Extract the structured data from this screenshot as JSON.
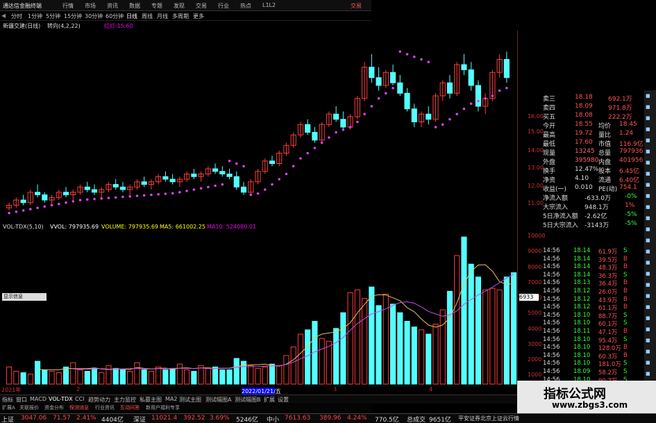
{
  "window_title": "通达信金融终端",
  "menu": [
    "行情",
    "市场",
    "资讯",
    "数据",
    "专题",
    "发现",
    "交易",
    "行业",
    "热点",
    "L1L2",
    "交易"
  ],
  "periods": [
    "分时",
    "1分钟",
    "5分钟",
    "15分钟",
    "30分钟",
    "60分钟",
    "日线",
    "周线",
    "月线",
    "多周期",
    "更多"
  ],
  "stock_line": {
    "name": "新疆交建(日线)",
    "indicator": "转向(4,2,22)",
    "extra": "红灯:15.60"
  },
  "indicator_bar": {
    "name": "VOL-TDX(5,10)",
    "vvol": "VVOL: 797935.69",
    "volume": "VOLUME: 797935.69",
    "ma5": "MA5: 661002.25",
    "ma10": "MA10: 524080.01"
  },
  "y_axis_price": [
    "16.00",
    "15.00",
    "14.00",
    "13.00",
    "12.00",
    "11.00"
  ],
  "y_axis_vol": [
    "10000",
    "9000",
    "8000",
    "7000",
    "6000",
    "5000",
    "4000",
    "3000",
    "2000",
    "1000"
  ],
  "vol_label": "6933",
  "popup": "显示信息",
  "date_left": "2021年",
  "date_box": "2022/01/21/五",
  "date_marks": [
    "2",
    "3",
    "4"
  ],
  "tabs": [
    "指标",
    "窗口",
    "MACD",
    "VOL-TDX",
    "CCI",
    "趋势动力",
    "主力监控",
    "私募主图",
    "MA2",
    "测试主图",
    "测试幅图A",
    "测试幅图B",
    "扩展",
    "设置"
  ],
  "tabs2": [
    "扩展A",
    "关联报价",
    "资金分布",
    "探测消息",
    "行业资讯",
    "互动问答",
    "新用户福利专享"
  ],
  "quotes": [
    {
      "label": "卖三",
      "v1": "18.18",
      "v2": "692.1万"
    },
    {
      "label": "卖四",
      "v1": "18.09",
      "v2": "971.8万"
    },
    {
      "label": "买五",
      "v1": "18.08",
      "v2": "222.2万"
    },
    {
      "label": "今开",
      "v1": "18.55",
      "k2": "均价",
      "v2": "18.45"
    },
    {
      "label": "最高",
      "v1": "19.72",
      "k2": "量比",
      "v2": "1.24"
    },
    {
      "label": "最低",
      "v1": "17.60",
      "k2": "市值",
      "v2": "116.9亿"
    },
    {
      "label": "现量",
      "v1": "13245",
      "k2": "总量",
      "v2": "797936"
    },
    {
      "label": "外盘",
      "v1": "395980",
      "k2": "内盘",
      "v2": "401956"
    },
    {
      "label": "换手",
      "v1": "12.47%",
      "k2": "股本",
      "v2": "6.45亿"
    },
    {
      "label": "净资",
      "v1": "4.10",
      "k2": "流通",
      "v2": "6.40亿"
    },
    {
      "label": "收益(一)",
      "v1": "0.010",
      "k2": "PE(动)",
      "v2": "754.1"
    },
    {
      "label": "净流入额",
      "v1": "-633.0万",
      "v2": "-0%"
    },
    {
      "label": "大宗流入",
      "v1": "948.1万",
      "v2": "1%"
    },
    {
      "label": "5日净流入额",
      "v1": "-2.62亿",
      "v2": "-5%"
    },
    {
      "label": "5日大宗流入",
      "v1": "-3143万",
      "v2": "-5%"
    }
  ],
  "ticks": [
    [
      "14:56",
      "18.14",
      "61.9万",
      "S"
    ],
    [
      "14:56",
      "18.14",
      "39.5万",
      "B"
    ],
    [
      "14:56",
      "18.14",
      "48.3万",
      "B"
    ],
    [
      "14:56",
      "18.14",
      "36.3万",
      "S"
    ],
    [
      "14:56",
      "18.13",
      "36.4万",
      "B"
    ],
    [
      "14:56",
      "18.12",
      "26.0万",
      "B"
    ],
    [
      "14:56",
      "18.12",
      "43.9万",
      "B"
    ],
    [
      "14:56",
      "18.12",
      "61.1万",
      "B"
    ],
    [
      "14:56",
      "18.10",
      "88.7万",
      "S"
    ],
    [
      "14:56",
      "18.10",
      "60.1万",
      "S"
    ],
    [
      "14:56",
      "18.11",
      "47.1万",
      "B"
    ],
    [
      "14:56",
      "18.10",
      "95.4万",
      "S"
    ],
    [
      "14:56",
      "18.10",
      "128.0万",
      "B"
    ],
    [
      "14:56",
      "18.10",
      "60.3万",
      "B"
    ],
    [
      "14:56",
      "18.10",
      "181.0万",
      "S"
    ],
    [
      "14:56",
      "18.09",
      "58.2万",
      "S"
    ],
    [
      "14:56",
      "18.10",
      "90.7万",
      "S"
    ]
  ],
  "status": [
    {
      "label": "上证",
      "value": "3047.06",
      "chg": "71.57",
      "pct": "2.41%",
      "amt": "4404亿"
    },
    {
      "label": "深证",
      "value": "11021.4",
      "chg": "392.52",
      "pct": "3.69%",
      "amt": "5246亿"
    },
    {
      "label": "中小",
      "value": "7613.63",
      "chg": "389.96",
      "pct": "4.24%",
      "amt": "770.5亿"
    },
    {
      "label": "总成交",
      "value": "9651亿"
    },
    {
      "label": "info",
      "value": "平安证券北京上证云行情"
    }
  ],
  "watermark": {
    "title": "指标公式网",
    "url": "www.zbgs3.com"
  },
  "chart_data": {
    "type": "bar",
    "candles": [
      [
        10.9,
        11.1,
        10.8,
        11.0
      ],
      [
        11.0,
        11.3,
        10.9,
        11.2
      ],
      [
        11.2,
        11.4,
        11.0,
        11.1
      ],
      [
        11.1,
        11.6,
        11.0,
        11.5
      ],
      [
        11.5,
        11.8,
        11.3,
        11.4
      ],
      [
        11.4,
        11.5,
        11.1,
        11.2
      ],
      [
        11.2,
        11.4,
        11.0,
        11.3
      ],
      [
        11.3,
        11.6,
        11.2,
        11.5
      ],
      [
        11.5,
        11.7,
        11.3,
        11.4
      ],
      [
        11.4,
        11.6,
        11.2,
        11.5
      ],
      [
        11.5,
        11.8,
        11.4,
        11.7
      ],
      [
        11.7,
        11.9,
        11.5,
        11.6
      ],
      [
        11.6,
        11.8,
        11.4,
        11.5
      ],
      [
        11.5,
        11.7,
        11.3,
        11.6
      ],
      [
        11.6,
        11.9,
        11.5,
        11.8
      ],
      [
        11.8,
        12.0,
        11.6,
        11.7
      ],
      [
        11.7,
        11.9,
        11.5,
        11.6
      ],
      [
        11.6,
        11.8,
        11.4,
        11.7
      ],
      [
        11.7,
        12.0,
        11.6,
        11.9
      ],
      [
        11.9,
        12.1,
        11.7,
        11.8
      ],
      [
        11.8,
        12.0,
        11.6,
        11.9
      ],
      [
        11.9,
        12.2,
        11.8,
        12.1
      ],
      [
        12.1,
        12.3,
        11.9,
        12.0
      ],
      [
        12.0,
        12.2,
        11.8,
        11.9
      ],
      [
        11.9,
        12.1,
        11.7,
        12.0
      ],
      [
        12.0,
        12.3,
        11.9,
        12.2
      ],
      [
        12.2,
        12.4,
        12.0,
        12.1
      ],
      [
        12.1,
        12.3,
        11.9,
        12.2
      ],
      [
        12.2,
        12.5,
        12.1,
        12.4
      ],
      [
        12.4,
        12.6,
        12.2,
        12.3
      ],
      [
        12.3,
        12.5,
        12.1,
        12.2
      ],
      [
        12.2,
        12.4,
        12.0,
        12.1
      ],
      [
        12.1,
        12.3,
        11.6,
        11.7
      ],
      [
        11.7,
        11.9,
        11.4,
        11.5
      ],
      [
        11.5,
        12.0,
        11.4,
        11.9
      ],
      [
        11.9,
        12.4,
        11.8,
        12.3
      ],
      [
        12.3,
        12.8,
        12.2,
        12.7
      ],
      [
        12.7,
        12.9,
        12.5,
        12.6
      ],
      [
        12.6,
        13.1,
        12.5,
        13.0
      ],
      [
        13.0,
        13.4,
        12.9,
        13.3
      ],
      [
        13.3,
        13.8,
        13.2,
        13.7
      ],
      [
        13.7,
        14.2,
        13.6,
        14.1
      ],
      [
        14.1,
        14.3,
        13.7,
        13.8
      ],
      [
        13.8,
        14.0,
        13.4,
        13.5
      ],
      [
        13.5,
        14.2,
        13.4,
        14.1
      ],
      [
        14.1,
        14.6,
        14.0,
        14.5
      ],
      [
        14.5,
        14.8,
        14.2,
        14.3
      ],
      [
        14.3,
        14.6,
        13.9,
        14.0
      ],
      [
        14.0,
        14.5,
        13.9,
        14.4
      ],
      [
        14.4,
        15.2,
        14.3,
        15.1
      ],
      [
        15.1,
        16.5,
        15.0,
        16.3
      ],
      [
        16.3,
        16.8,
        15.7,
        15.9
      ],
      [
        15.9,
        16.3,
        15.4,
        15.6
      ],
      [
        15.6,
        16.2,
        15.5,
        16.1
      ],
      [
        16.1,
        16.4,
        15.6,
        15.7
      ],
      [
        15.7,
        16.0,
        15.2,
        15.3
      ],
      [
        15.3,
        15.5,
        14.6,
        14.7
      ],
      [
        14.7,
        14.9,
        14.0,
        14.2
      ],
      [
        14.2,
        14.6,
        14.0,
        14.5
      ],
      [
        14.5,
        14.8,
        14.1,
        14.3
      ],
      [
        14.3,
        15.3,
        14.2,
        15.2
      ],
      [
        15.2,
        15.8,
        15.0,
        15.7
      ],
      [
        15.7,
        16.0,
        15.1,
        15.3
      ],
      [
        15.3,
        16.5,
        15.2,
        16.4
      ],
      [
        16.4,
        16.8,
        16.0,
        16.2
      ],
      [
        16.2,
        16.5,
        15.4,
        15.6
      ],
      [
        15.6,
        15.8,
        14.6,
        14.8
      ],
      [
        14.8,
        15.3,
        14.5,
        15.1
      ],
      [
        15.1,
        16.2,
        15.0,
        16.1
      ],
      [
        16.1,
        16.8,
        15.9,
        16.6
      ],
      [
        16.6,
        16.9,
        15.7,
        15.9
      ]
    ],
    "sar": [
      10.7,
      10.75,
      10.8,
      10.85,
      10.9,
      10.95,
      11.0,
      11.05,
      11.1,
      11.15,
      11.2,
      11.22,
      11.24,
      11.26,
      11.28,
      11.3,
      11.32,
      11.34,
      11.36,
      11.38,
      11.4,
      11.42,
      11.44,
      11.46,
      11.5,
      11.55,
      11.6,
      11.65,
      11.7,
      11.75,
      11.8,
      12.7,
      12.6,
      12.5,
      11.4,
      11.45,
      11.6,
      11.8,
      12.0,
      12.2,
      12.5,
      12.8,
      13.0,
      13.2,
      13.4,
      13.6,
      13.8,
      13.9,
      14.0,
      14.2,
      14.5,
      14.8,
      15.1,
      15.3,
      15.5,
      16.9,
      16.8,
      16.7,
      16.6,
      16.5,
      14.0,
      14.1,
      14.3,
      14.5,
      14.7,
      14.9,
      15.0,
      15.1,
      15.2,
      15.4,
      15.5
    ],
    "volume": [
      1200,
      900,
      800,
      700,
      1600,
      1000,
      900,
      800,
      1200,
      1500,
      1000,
      900,
      1100,
      800,
      1300,
      1100,
      1000,
      900,
      1500,
      1000,
      900,
      1200,
      1000,
      1100,
      1400,
      1000,
      900,
      1300,
      1100,
      1200,
      1000,
      1000,
      1800,
      1600,
      1300,
      1100,
      1200,
      1400,
      1300,
      2000,
      2600,
      3500,
      3800,
      4400,
      3200,
      3000,
      3900,
      5000,
      6400,
      6600,
      6000,
      6800,
      5500,
      6300,
      5600,
      5000,
      4400,
      4000,
      3800,
      3500,
      4200,
      5200,
      6500,
      9000,
      10300,
      8400,
      7500,
      6600,
      6700,
      6600,
      7500,
      7800
    ]
  }
}
